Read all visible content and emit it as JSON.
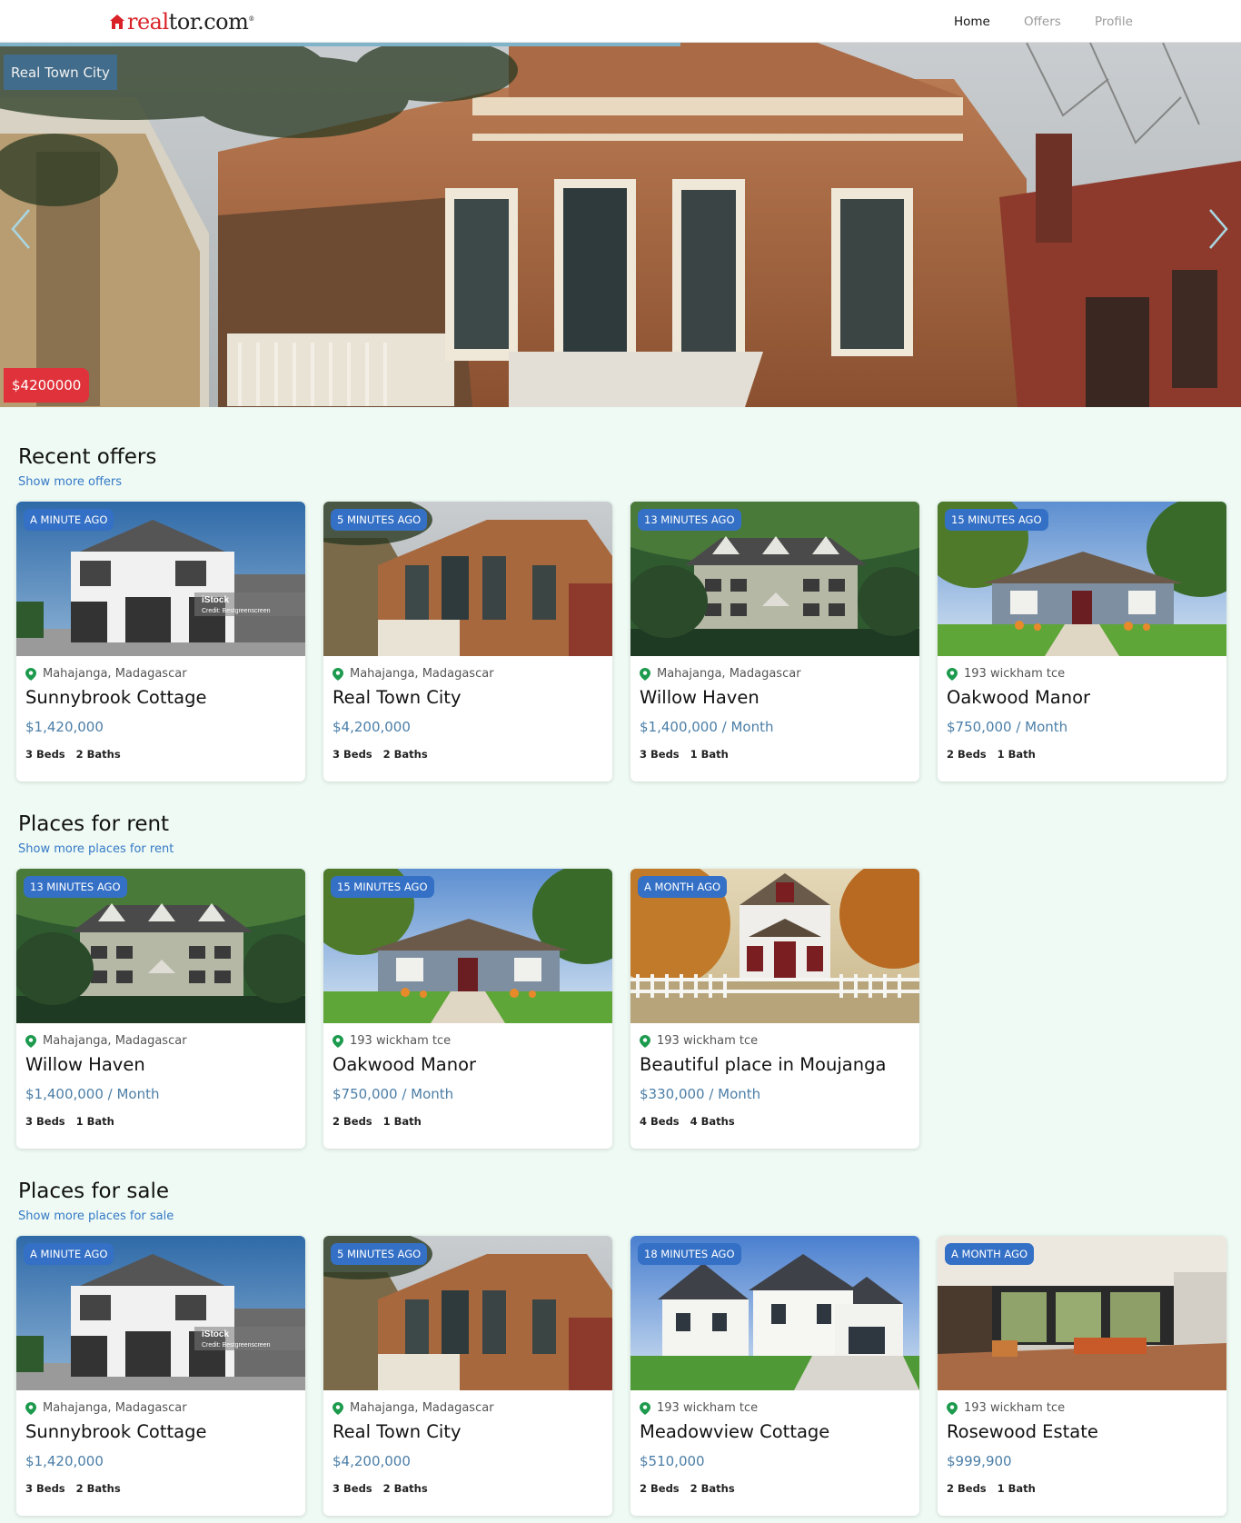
{
  "header": {
    "logo": {
      "part1": "real",
      "part2": "tor.com",
      "trademark": "®",
      "icon": "house-icon"
    },
    "nav": [
      {
        "label": "Home",
        "active": true
      },
      {
        "label": "Offers",
        "active": false
      },
      {
        "label": "Profile",
        "active": false
      }
    ]
  },
  "hero": {
    "title": "Real Town City",
    "price": "$4200000",
    "progress": 0.4,
    "prev_icon": "chevron-left-icon",
    "next_icon": "chevron-right-icon"
  },
  "sections": {
    "recent": {
      "title": "Recent offers",
      "link": "Show more offers",
      "cards": [
        {
          "badge": "A MINUTE AGO",
          "location": "Mahajanga, Madagascar",
          "name": "Sunnybrook Cottage",
          "price": "$1,420,000",
          "beds": "3 Beds",
          "baths": "2 Baths",
          "watermark": "iStock",
          "credit": "Credit: Bestgreenscreen"
        },
        {
          "badge": "5 MINUTES AGO",
          "location": "Mahajanga, Madagascar",
          "name": "Real Town City",
          "price": "$4,200,000",
          "beds": "3 Beds",
          "baths": "2 Baths"
        },
        {
          "badge": "13 MINUTES AGO",
          "location": "Mahajanga, Madagascar",
          "name": "Willow Haven",
          "price": "$1,400,000 / Month",
          "beds": "3 Beds",
          "baths": "1 Bath"
        },
        {
          "badge": "15 MINUTES AGO",
          "location": "193 wickham tce",
          "name": "Oakwood Manor",
          "price": "$750,000 / Month",
          "beds": "2 Beds",
          "baths": "1 Bath"
        }
      ]
    },
    "rent": {
      "title": "Places for rent",
      "link": "Show more places for rent",
      "cards": [
        {
          "badge": "13 MINUTES AGO",
          "location": "Mahajanga, Madagascar",
          "name": "Willow Haven",
          "price": "$1,400,000 / Month",
          "beds": "3 Beds",
          "baths": "1 Bath"
        },
        {
          "badge": "15 MINUTES AGO",
          "location": "193 wickham tce",
          "name": "Oakwood Manor",
          "price": "$750,000 / Month",
          "beds": "2 Beds",
          "baths": "1 Bath"
        },
        {
          "badge": "A MONTH AGO",
          "location": "193 wickham tce",
          "name": "Beautiful place in Moujanga",
          "price": "$330,000 / Month",
          "beds": "4 Beds",
          "baths": "4 Baths"
        }
      ]
    },
    "sale": {
      "title": "Places for sale",
      "link": "Show more places for sale",
      "cards": [
        {
          "badge": "A MINUTE AGO",
          "location": "Mahajanga, Madagascar",
          "name": "Sunnybrook Cottage",
          "price": "$1,420,000",
          "beds": "3 Beds",
          "baths": "2 Baths",
          "watermark": "iStock",
          "credit": "Credit: Bestgreenscreen"
        },
        {
          "badge": "5 MINUTES AGO",
          "location": "Mahajanga, Madagascar",
          "name": "Real Town City",
          "price": "$4,200,000",
          "beds": "3 Beds",
          "baths": "2 Baths"
        },
        {
          "badge": "18 MINUTES AGO",
          "location": "193 wickham tce",
          "name": "Meadowview Cottage",
          "price": "$510,000",
          "beds": "2 Beds",
          "baths": "2 Baths"
        },
        {
          "badge": "A MONTH AGO",
          "location": "193 wickham tce",
          "name": "Rosewood Estate",
          "price": "$999,900",
          "beds": "2 Beds",
          "baths": "1 Bath"
        }
      ]
    }
  },
  "colors": {
    "brand_red": "#d92228",
    "badge_blue": "#3470c5",
    "price_blue": "#4b7ea7",
    "link_blue": "#3679c8",
    "page_bg": "#eefaf3",
    "pin_green": "#1c9a4d"
  }
}
